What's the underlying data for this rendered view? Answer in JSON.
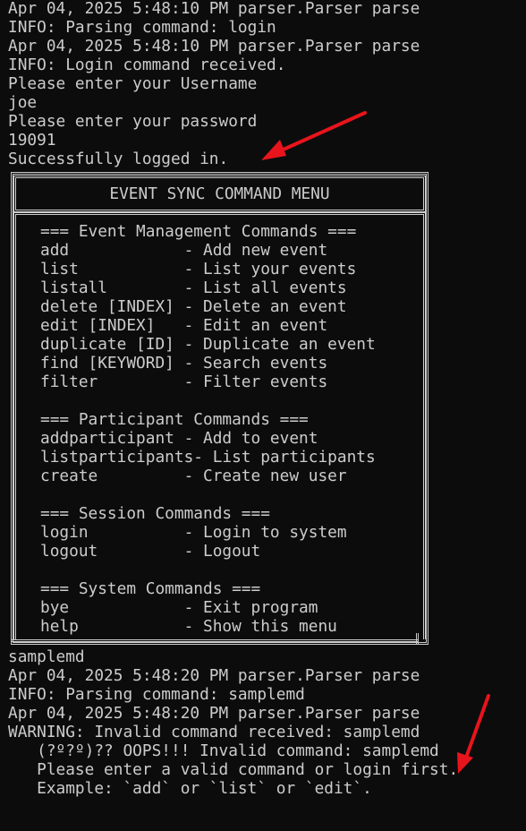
{
  "log_top": [
    "Apr 04, 2025 5:48:10 PM parser.Parser parse",
    "INFO: Parsing command: login",
    "Apr 04, 2025 5:48:10 PM parser.Parser parse",
    "INFO: Login command received.",
    "Please enter your Username",
    "joe",
    "Please enter your password",
    "19091",
    "Successfully logged in."
  ],
  "menu": {
    "title": "EVENT SYNC COMMAND MENU",
    "lines": [
      "=== Event Management Commands ===",
      "add            - Add new event",
      "list           - List your events",
      "listall        - List all events",
      "delete [INDEX] - Delete an event",
      "edit [INDEX]   - Edit an event",
      "duplicate [ID] - Duplicate an event",
      "find [KEYWORD] - Search events",
      "filter         - Filter events",
      "",
      "=== Participant Commands ===",
      "addparticipant - Add to event",
      "listparticipants- List participants",
      "create         - Create new user",
      "",
      "=== Session Commands ===",
      "login          - Login to system",
      "logout         - Logout",
      "",
      "=== System Commands ===",
      "bye            - Exit program",
      "help           - Show this menu"
    ]
  },
  "log_bottom": [
    "samplemd",
    "Apr 04, 2025 5:48:20 PM parser.Parser parse",
    "INFO: Parsing command: samplemd",
    "Apr 04, 2025 5:48:20 PM parser.Parser parse",
    "WARNING: Invalid command received: samplemd",
    "   (?º?º)?? OOPS!!! Invalid command: samplemd",
    "   Please enter a valid command or login first.",
    "   Example: `add` or `list` or `edit`."
  ],
  "colors": {
    "background": "#0c0c0c",
    "text": "#cccccc",
    "arrow": "#e8141c"
  },
  "annotations": [
    "arrow-icon",
    "arrow-icon"
  ]
}
